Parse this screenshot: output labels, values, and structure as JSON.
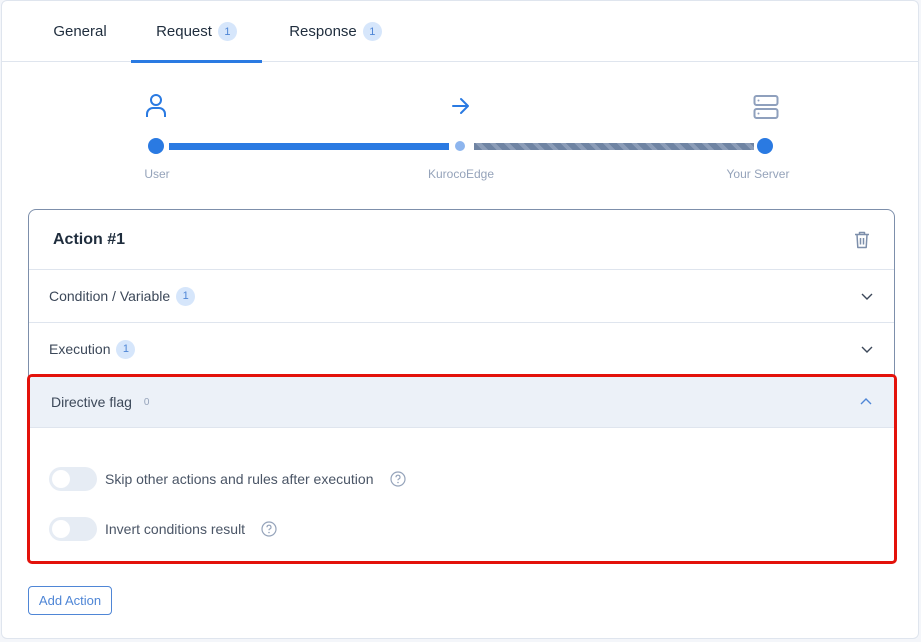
{
  "tabs": [
    {
      "label": "General",
      "badge": null,
      "active": false
    },
    {
      "label": "Request",
      "badge": "1",
      "active": true
    },
    {
      "label": "Response",
      "badge": "1",
      "active": false
    }
  ],
  "flow": {
    "nodes": [
      {
        "label": "User",
        "icon": "user-icon"
      },
      {
        "label": "KurocoEdge",
        "icon": "arrow-right-icon"
      },
      {
        "label": "Your Server",
        "icon": "server-icon"
      }
    ]
  },
  "action": {
    "title": "Action #1",
    "sections": [
      {
        "label": "Condition / Variable",
        "badge": "1",
        "expanded": false
      },
      {
        "label": "Execution",
        "badge": "1",
        "expanded": false
      }
    ],
    "directive": {
      "label": "Directive flag",
      "count": "0",
      "expanded": true,
      "toggles": [
        {
          "label": "Skip other actions and rules after execution",
          "on": false
        },
        {
          "label": "Invert conditions result",
          "on": false
        }
      ]
    }
  },
  "buttons": {
    "add_action": "Add Action"
  },
  "colors": {
    "accent": "#2a7ae2",
    "highlight_border": "#e3120b",
    "badge_bg": "#d6e6fb"
  }
}
